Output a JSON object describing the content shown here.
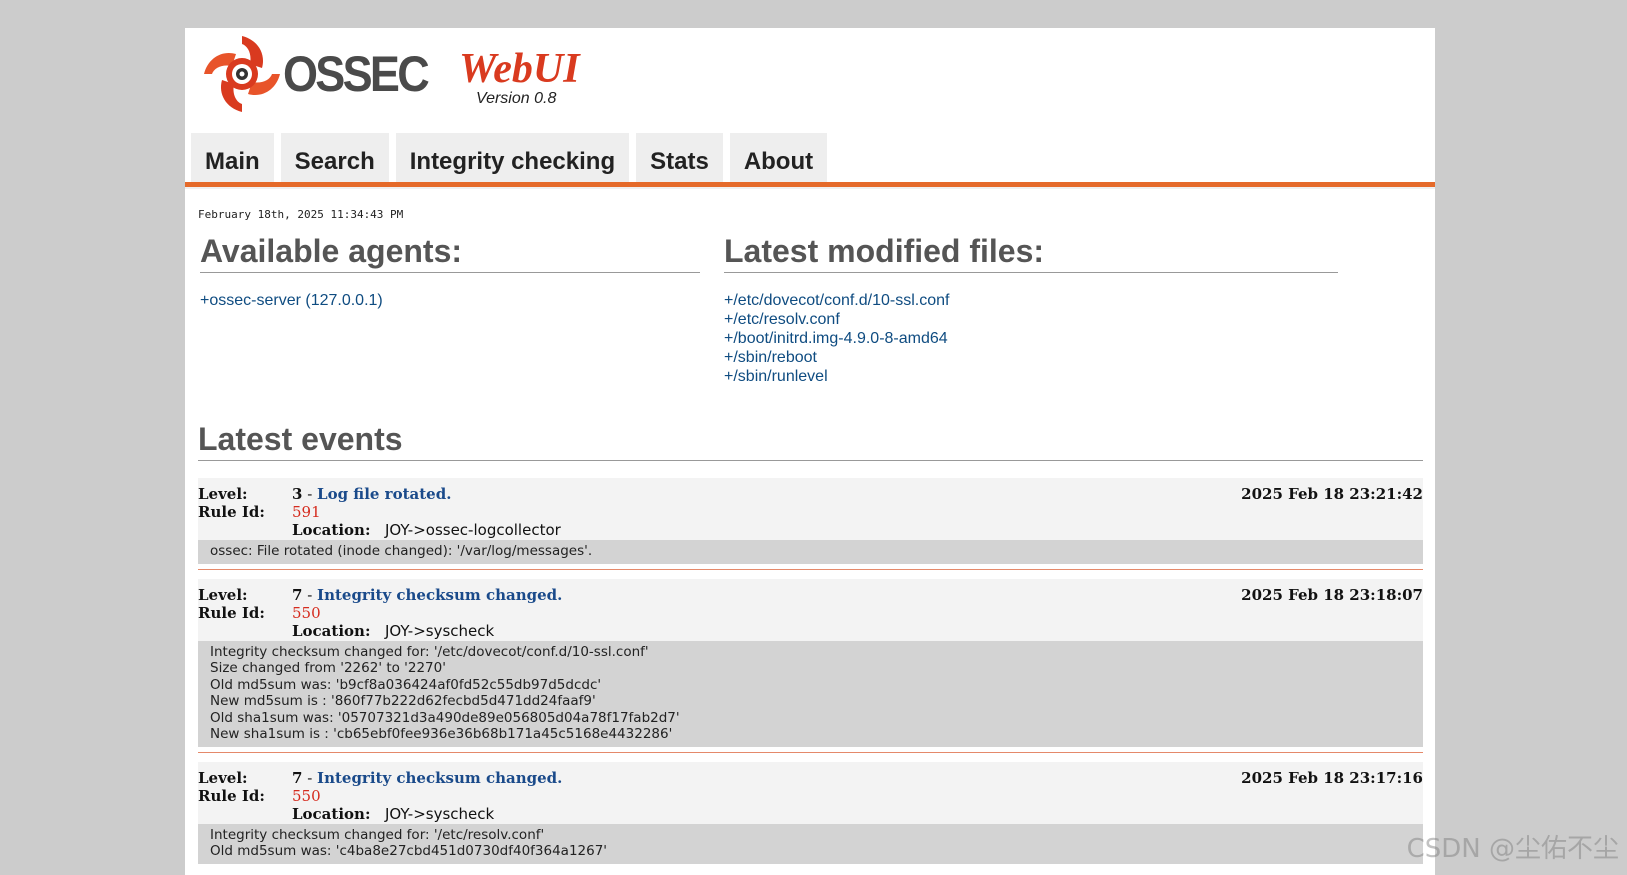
{
  "header": {
    "logo_text": "OSSEC",
    "logo_script": "WebUI",
    "version": "Version 0.8"
  },
  "nav": {
    "tabs": [
      {
        "label": "Main"
      },
      {
        "label": "Search"
      },
      {
        "label": "Integrity checking"
      },
      {
        "label": "Stats"
      },
      {
        "label": "About"
      }
    ]
  },
  "datetime": "February 18th, 2025 11:34:43 PM",
  "agents": {
    "title": "Available agents:",
    "items": [
      "+ossec-server (127.0.0.1)"
    ]
  },
  "files": {
    "title": "Latest modified files:",
    "items": [
      "+/etc/dovecot/conf.d/10-ssl.conf",
      "+/etc/resolv.conf",
      "+/boot/initrd.img-4.9.0-8-amd64",
      "+/sbin/reboot",
      "+/sbin/runlevel"
    ]
  },
  "events": {
    "title": "Latest events",
    "labels": {
      "level": "Level:",
      "rule": "Rule Id:",
      "location": "Location:"
    },
    "items": [
      {
        "level": "3",
        "description": "Log file rotated.",
        "rule_id": "591",
        "location": "JOY->ossec-logcollector",
        "time": "2025 Feb 18 23:21:42",
        "details": [
          "ossec: File rotated (inode changed): '/var/log/messages'."
        ]
      },
      {
        "level": "7",
        "description": "Integrity checksum changed.",
        "rule_id": "550",
        "location": "JOY->syscheck",
        "time": "2025 Feb 18 23:18:07",
        "details": [
          "Integrity checksum changed for: '/etc/dovecot/conf.d/10-ssl.conf'",
          "Size changed from '2262' to '2270'",
          "Old md5sum was: 'b9cf8a036424af0fd52c55db97d5dcdc'",
          "New md5sum is : '860f77b222d62fecbd5d471dd24faaf9'",
          "Old sha1sum was: '05707321d3a490de89e056805d04a78f17fab2d7'",
          "New sha1sum is : 'cb65ebf0fee936e36b68b171a45c5168e4432286'"
        ]
      },
      {
        "level": "7",
        "description": "Integrity checksum changed.",
        "rule_id": "550",
        "location": "JOY->syscheck",
        "time": "2025 Feb 18 23:17:16",
        "details": [
          "Integrity checksum changed for: '/etc/resolv.conf'",
          "Old md5sum was: 'c4ba8e27cbd451d0730df40f364a1267'"
        ]
      }
    ]
  },
  "watermark": "CSDN @尘佑不尘",
  "colors": {
    "accent_bar": "#e56a2a",
    "link": "#0f4c81",
    "rule_id": "#d52b1e",
    "logo_red": "#d93a1f"
  }
}
